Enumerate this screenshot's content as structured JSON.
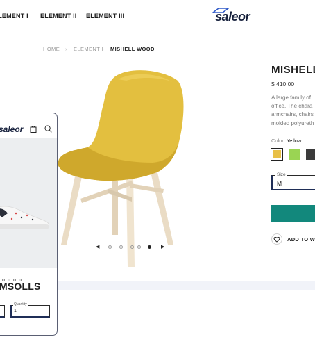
{
  "nav": {
    "items": [
      {
        "label": "ELEMENT I"
      },
      {
        "label": "ELEMENT II"
      },
      {
        "label": "ELEMENT III"
      }
    ],
    "logo": "saleor"
  },
  "breadcrumb": {
    "home": "HOME",
    "parent": "ELEMENT I",
    "current": "MISHELL WOOD",
    "separator": "›"
  },
  "gallery": {
    "slides": 5,
    "active_index": 4,
    "prev_icon": "caret-left-icon",
    "next_icon": "caret-right-icon"
  },
  "product": {
    "title": "MISHELL",
    "price": "$ 410.00",
    "description_lines": [
      "A large family of",
      "office. The chara",
      "armchairs, chairs",
      "molded polyureth"
    ],
    "color_label": "Color:",
    "color_value": "Yellow",
    "swatches": [
      {
        "name": "yellow",
        "color": "#e8c047",
        "selected": true
      },
      {
        "name": "green",
        "color": "#9ad453",
        "selected": false
      },
      {
        "name": "dark",
        "color": "#3b3b3b",
        "selected": false
      }
    ],
    "size_label": "Size",
    "size_value": "M",
    "add_to_cart_color": "#12887c",
    "wishlist_label": "ADD TO WIS"
  },
  "mobile": {
    "logo": "saleor",
    "title": "MSOLLS",
    "quantity_label": "Quantity",
    "quantity_value": "1",
    "slides": 4
  },
  "colors": {
    "accent": "#12887c",
    "brand_navy": "#17213d",
    "chair_yellow": "#e3bf3f"
  }
}
